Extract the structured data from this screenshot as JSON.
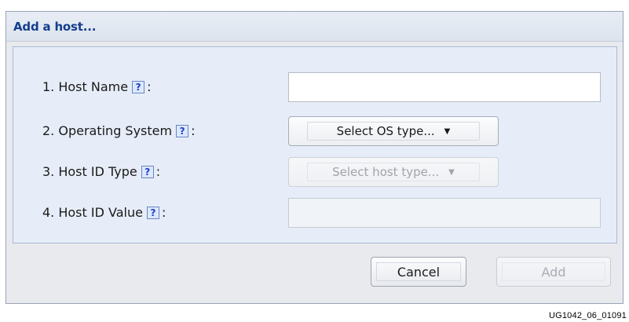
{
  "dialog": {
    "title": "Add a host..."
  },
  "form": {
    "help_glyph": "?",
    "colon": ":",
    "fields": [
      {
        "label": "1. Host Name",
        "type": "text",
        "value": "",
        "enabled": true
      },
      {
        "label": "2. Operating System",
        "type": "select",
        "value": "Select OS type...",
        "enabled": true
      },
      {
        "label": "3. Host ID Type",
        "type": "select",
        "value": "Select host type...",
        "enabled": false
      },
      {
        "label": "4. Host ID Value",
        "type": "text",
        "value": "",
        "enabled": false
      }
    ]
  },
  "buttons": {
    "cancel": "Cancel",
    "add": "Add"
  },
  "figure_id": "UG1042_06_01091",
  "icons": {
    "dropdown": "chevron-down-icon",
    "help": "help-icon"
  },
  "colors": {
    "title": "#153e8d",
    "help_text": "#1d3fc9",
    "panel_bg": "#e6edf8",
    "dialog_bg": "#e9eaee"
  }
}
